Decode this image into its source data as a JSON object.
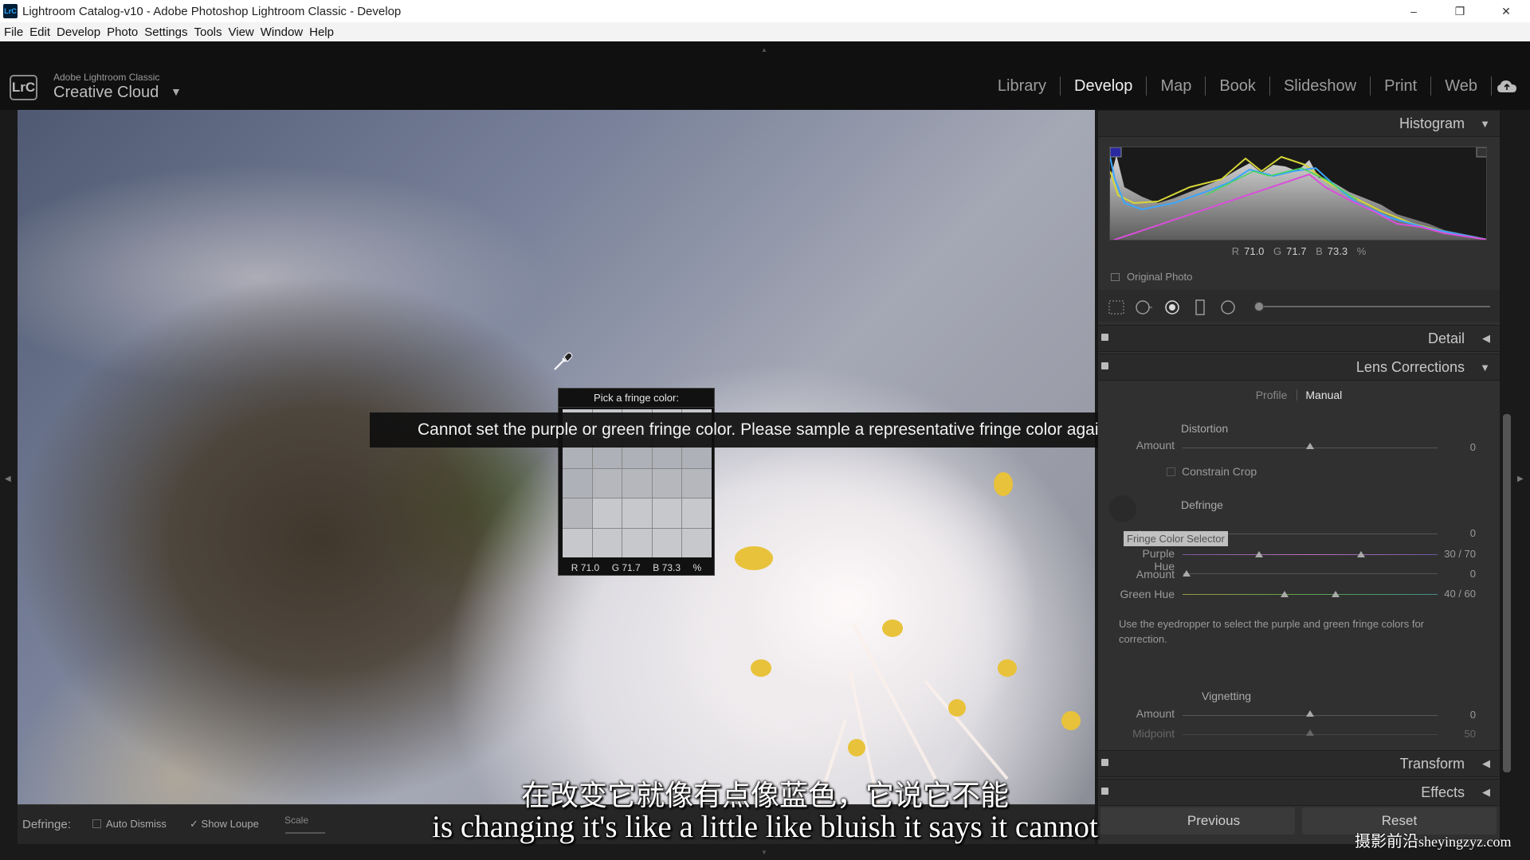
{
  "window": {
    "title": "Lightroom Catalog-v10 - Adobe Photoshop Lightroom Classic - Develop",
    "app_badge": "LrC",
    "minimize": "–",
    "restore": "❐",
    "close": "✕"
  },
  "menu": [
    "File",
    "Edit",
    "Develop",
    "Photo",
    "Settings",
    "Tools",
    "View",
    "Window",
    "Help"
  ],
  "header": {
    "logo": "LrC",
    "brand_small": "Adobe Lightroom Classic",
    "brand_big": "Creative Cloud",
    "brand_caret": "▼",
    "modules": [
      "Library",
      "Develop",
      "Map",
      "Book",
      "Slideshow",
      "Print",
      "Web"
    ],
    "active_module": "Develop"
  },
  "fringe_picker": {
    "title": "Pick a fringe color:",
    "r_label": "R",
    "r_value": "71.0",
    "g_label": "G",
    "g_value": "71.7",
    "b_label": "B",
    "b_value": "73.3",
    "unit": "%"
  },
  "warning": "Cannot set the purple or green fringe color. Please sample a representative fringe color again.",
  "toolbar": {
    "defringe_label": "Defringe:",
    "auto_dismiss": "Auto Dismiss",
    "show_loupe_check": "✓",
    "show_loupe": "Show Loupe",
    "scale": "Scale"
  },
  "right_panel": {
    "histogram": {
      "title": "Histogram",
      "r_label": "R",
      "r_value": "71.0",
      "g_label": "G",
      "g_value": "71.7",
      "b_label": "B",
      "b_value": "73.3",
      "unit": "%",
      "original_photo": "Original Photo"
    },
    "detail_title": "Detail",
    "lens_corrections": {
      "title": "Lens Corrections",
      "tab_profile": "Profile",
      "tab_manual": "Manual",
      "distortion": {
        "label": "Distortion",
        "amount_label": "Amount",
        "amount_value": "0",
        "amount_level": 0.5,
        "constrain_crop": "Constrain Crop"
      },
      "defringe": {
        "label": "Defringe",
        "tooltip": "Fringe Color Selector",
        "purple_amount_label": "Amount",
        "purple_amount_value": "0",
        "purple_hue_label": "Purple Hue",
        "purple_hue_value": "30 / 70",
        "purple_hue_range": [
          30,
          70
        ],
        "green_amount_label": "Amount",
        "green_amount_value": "0",
        "green_hue_label": "Green Hue",
        "green_hue_value": "40 / 60",
        "green_hue_range": [
          40,
          60
        ],
        "hint": "Use the eyedropper to select the purple and green fringe colors for correction."
      },
      "vignetting": {
        "label": "Vignetting",
        "amount_label": "Amount",
        "amount_value": "0",
        "midpoint_label": "Midpoint",
        "midpoint_value": "50"
      }
    },
    "transform_title": "Transform",
    "effects_title": "Effects",
    "previous_button": "Previous",
    "reset_button": "Reset"
  },
  "subtitles": {
    "chinese": "在改变它就像有点像蓝色，它说它不能",
    "english": "is changing it's like a little like bluish it says it cannot"
  },
  "watermark": {
    "chinese": "摄影前沿",
    "site": "sheyingzyz.com"
  },
  "colors": {
    "panel_bg": "#303030",
    "header_bg": "#101010",
    "active_module": "#f0f0f0",
    "inactive_module": "#9c9c9c"
  }
}
